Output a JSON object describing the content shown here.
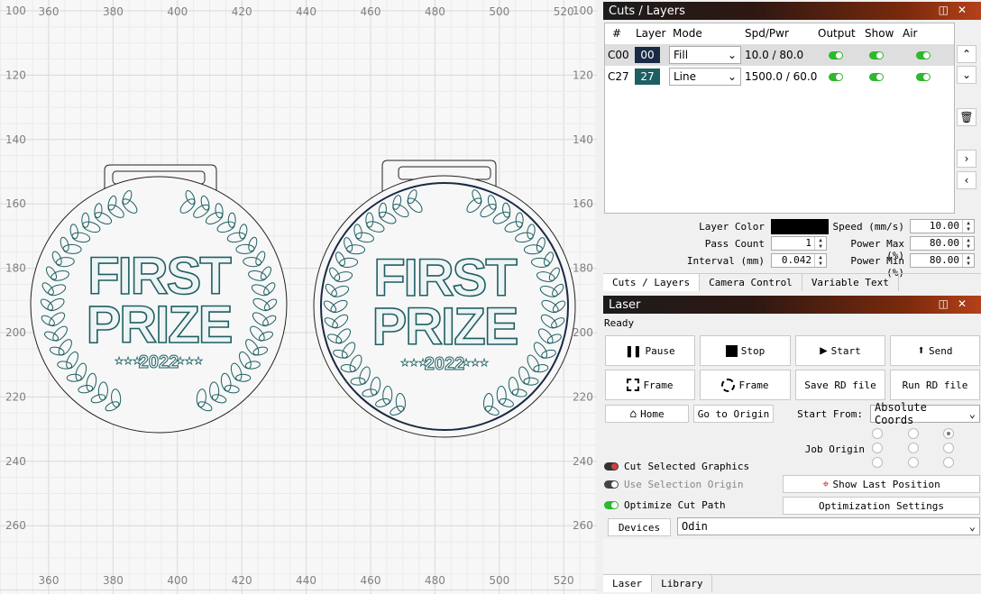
{
  "rulers": {
    "x_labels": [
      "360",
      "380",
      "400",
      "420",
      "440",
      "460",
      "480",
      "500",
      "520"
    ],
    "y_labels": [
      "100",
      "120",
      "140",
      "160",
      "180",
      "200",
      "220",
      "240",
      "260"
    ]
  },
  "medals": [
    {
      "title_line1": "FIRST",
      "title_line2": "PRIZE",
      "year": "2022"
    },
    {
      "title_line1": "FIRST",
      "title_line2": "PRIZE",
      "year": "2022"
    }
  ],
  "cuts_panel": {
    "title": "Cuts / Layers",
    "headers": {
      "num": "#",
      "layer": "Layer",
      "mode": "Mode",
      "spd": "Spd/Pwr",
      "output": "Output",
      "show": "Show",
      "air": "Air"
    },
    "rows": [
      {
        "num": "C00",
        "layer": "00",
        "color": "#1a2a44",
        "mode": "Fill",
        "spd": "10.0 / 80.0"
      },
      {
        "num": "C27",
        "layer": "27",
        "color": "#1d5f63",
        "mode": "Line",
        "spd": "1500.0 / 60.0"
      }
    ],
    "layer_color_label": "Layer Color",
    "pass_count_label": "Pass Count",
    "pass_count": "1",
    "interval_label": "Interval (mm)",
    "interval": "0.042",
    "speed_label": "Speed (mm/s)",
    "speed": "10.00",
    "power_max_label": "Power Max (%)",
    "power_max": "80.00",
    "power_min_label": "Power Min (%)",
    "power_min": "80.00",
    "tabs": [
      "Cuts / Layers",
      "Camera Control",
      "Variable Text"
    ]
  },
  "laser_panel": {
    "title": "Laser",
    "status": "Ready",
    "pause": "Pause",
    "stop": "Stop",
    "start": "Start",
    "send": "Send",
    "frame1": "Frame",
    "frame2": "Frame",
    "save_rd": "Save RD file",
    "run_rd": "Run RD file",
    "home": "Home",
    "go_origin": "Go to Origin",
    "start_from_label": "Start From:",
    "start_from": "Absolute Coords",
    "job_origin_label": "Job Origin",
    "cut_selected": "Cut Selected Graphics",
    "use_selection_origin": "Use Selection Origin",
    "optimize_cut": "Optimize Cut Path",
    "show_last": "Show Last Position",
    "opt_settings": "Optimization Settings",
    "devices": "Devices",
    "device": "Odin",
    "tabs": [
      "Laser",
      "Library"
    ]
  }
}
